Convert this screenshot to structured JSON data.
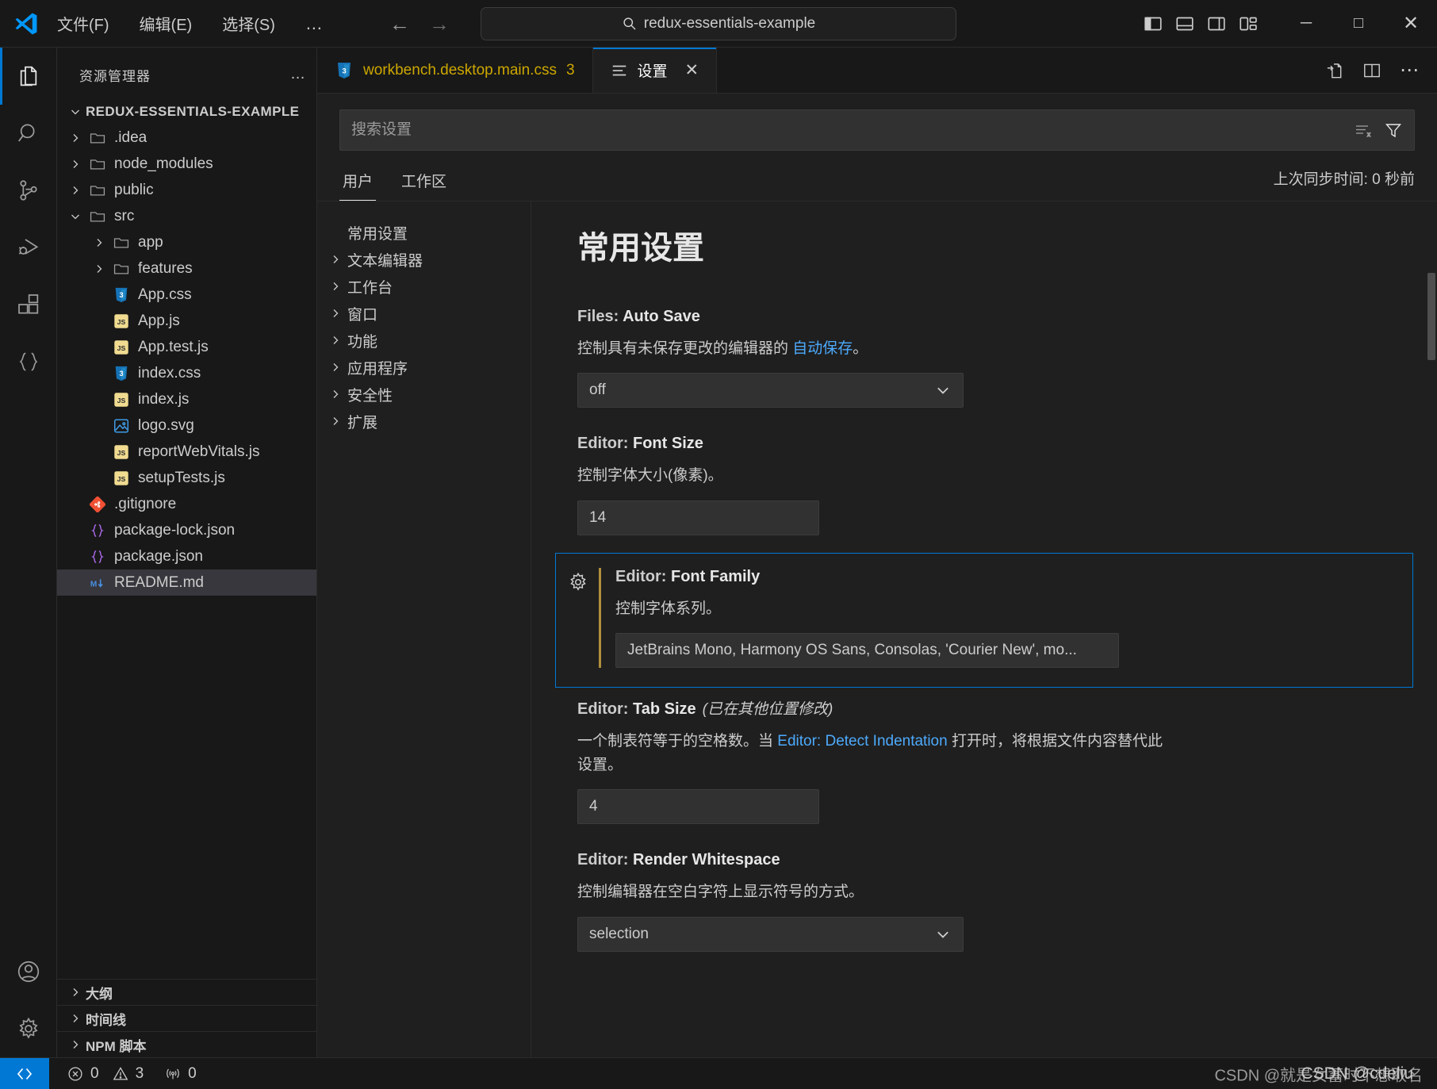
{
  "titlebar": {
    "logo_name": "vscode-logo",
    "menus": [
      "文件(F)",
      "编辑(E)",
      "选择(S)"
    ],
    "menu_overflow": "…",
    "nav_back": "←",
    "nav_forward": "→",
    "command_center": {
      "icon": "search-icon",
      "text": "redux-essentials-example"
    },
    "layout_icons": [
      "toggle-primary-sidebar-icon",
      "toggle-panel-icon",
      "toggle-secondary-sidebar-icon",
      "customize-layout-icon"
    ],
    "window_controls": {
      "minimize": "─",
      "maximize": "□",
      "close": "✕"
    }
  },
  "activitybar": {
    "items": [
      {
        "name": "explorer",
        "icon": "files-icon",
        "active": true
      },
      {
        "name": "search",
        "icon": "search-icon",
        "active": false
      },
      {
        "name": "source-control",
        "icon": "source-control-icon",
        "active": false
      },
      {
        "name": "run-and-debug",
        "icon": "debug-icon",
        "active": false
      },
      {
        "name": "extensions",
        "icon": "extensions-icon",
        "active": false
      },
      {
        "name": "remote-explorer",
        "icon": "braces-icon",
        "active": false
      }
    ],
    "bottom_items": [
      {
        "name": "accounts",
        "icon": "account-icon"
      },
      {
        "name": "manage",
        "icon": "gear-icon"
      }
    ]
  },
  "sidebar": {
    "title": "资源管理器",
    "more_actions": "…",
    "root": {
      "label": "REDUX-ESSENTIALS-EXAMPLE",
      "expanded": true
    },
    "tree": [
      {
        "label": ".idea",
        "type": "folder",
        "depth": 1,
        "expanded": false
      },
      {
        "label": "node_modules",
        "type": "folder",
        "depth": 1,
        "expanded": false
      },
      {
        "label": "public",
        "type": "folder",
        "depth": 1,
        "expanded": false
      },
      {
        "label": "src",
        "type": "folder",
        "depth": 1,
        "expanded": true
      },
      {
        "label": "app",
        "type": "folder",
        "depth": 2,
        "expanded": false
      },
      {
        "label": "features",
        "type": "folder",
        "depth": 2,
        "expanded": false
      },
      {
        "label": "App.css",
        "type": "css",
        "depth": 2
      },
      {
        "label": "App.js",
        "type": "js",
        "depth": 2
      },
      {
        "label": "App.test.js",
        "type": "js",
        "depth": 2
      },
      {
        "label": "index.css",
        "type": "css",
        "depth": 2
      },
      {
        "label": "index.js",
        "type": "js",
        "depth": 2
      },
      {
        "label": "logo.svg",
        "type": "svg",
        "depth": 2
      },
      {
        "label": "reportWebVitals.js",
        "type": "js",
        "depth": 2
      },
      {
        "label": "setupTests.js",
        "type": "js",
        "depth": 2
      },
      {
        "label": ".gitignore",
        "type": "git",
        "depth": 1
      },
      {
        "label": "package-lock.json",
        "type": "json",
        "depth": 1
      },
      {
        "label": "package.json",
        "type": "json",
        "depth": 1
      },
      {
        "label": "README.md",
        "type": "md",
        "depth": 1,
        "selected": true
      }
    ],
    "panels": [
      "大纲",
      "时间线",
      "NPM 脚本"
    ]
  },
  "editor": {
    "tabs": [
      {
        "label": "workbench.desktop.main.css",
        "badge": "3",
        "icon": "css-icon",
        "active": false
      },
      {
        "label": "设置",
        "icon": "settings-tab-icon",
        "active": true,
        "closable": true
      }
    ],
    "close_glyph": "✕",
    "actions": [
      "open-changes-icon",
      "split-editor-icon",
      "more-actions-icon"
    ],
    "more_glyph": "⋯"
  },
  "settings": {
    "search_placeholder": "搜索设置",
    "search_value": "",
    "search_icons": [
      "clear-filters-icon",
      "filter-icon"
    ],
    "scope_tabs": [
      {
        "label": "用户",
        "active": true
      },
      {
        "label": "工作区",
        "active": false
      }
    ],
    "sync_status": "上次同步时间: 0 秒前",
    "toc": [
      {
        "label": "常用设置",
        "hasArrow": false,
        "active": true
      },
      {
        "label": "文本编辑器",
        "hasArrow": true
      },
      {
        "label": "工作台",
        "hasArrow": true
      },
      {
        "label": "窗口",
        "hasArrow": true
      },
      {
        "label": "功能",
        "hasArrow": true
      },
      {
        "label": "应用程序",
        "hasArrow": true
      },
      {
        "label": "安全性",
        "hasArrow": true
      },
      {
        "label": "扩展",
        "hasArrow": true
      }
    ],
    "page_title": "常用设置",
    "items": [
      {
        "key": "files-auto-save",
        "prefix": "Files: ",
        "name": "Auto Save",
        "note": "",
        "desc_before": "控制具有未保存更改的编辑器的 ",
        "desc_link": "自动保存",
        "desc_after": "。",
        "control": "select",
        "value": "off",
        "caret": "⌄"
      },
      {
        "key": "editor-font-size",
        "prefix": "Editor: ",
        "name": "Font Size",
        "note": "",
        "desc_before": "控制字体大小(像素)。",
        "desc_link": "",
        "desc_after": "",
        "control": "input",
        "value": "14"
      },
      {
        "key": "editor-font-family",
        "prefix": "Editor: ",
        "name": "Font Family",
        "note": "",
        "desc_before": "控制字体系列。",
        "desc_link": "",
        "desc_after": "",
        "control": "input-wide",
        "value": "JetBrains Mono, Harmony OS Sans, Consolas, 'Courier New', mo...",
        "focused": true,
        "modified": true,
        "gear_icon": "gear-icon"
      },
      {
        "key": "editor-tab-size",
        "prefix": "Editor: ",
        "name": "Tab Size",
        "note": "(已在其他位置修改)",
        "desc_before": "一个制表符等于的空格数。当 ",
        "desc_link": "Editor: Detect Indentation",
        "desc_after": " 打开时，将根据文件内容替代此设置。",
        "control": "input",
        "value": "4"
      },
      {
        "key": "editor-render-whitespace",
        "prefix": "Editor: ",
        "name": "Render Whitespace",
        "note": "",
        "desc_before": "控制编辑器在空白字符上显示符号的方式。",
        "desc_link": "",
        "desc_after": "",
        "control": "select",
        "value": "selection",
        "caret": "⌄"
      }
    ]
  },
  "statusbar": {
    "remote_icon": "remote-window-icon",
    "problems": {
      "errors_icon": "error-icon",
      "errors": "0",
      "warnings_icon": "warning-icon",
      "warnings": "3"
    },
    "ports": {
      "icon": "radio-tower-icon",
      "count": "0"
    },
    "watermark": "CSDN @就是女蓄时不想取名",
    "watermark_overlay": "CSDN @cdeliu"
  },
  "colors": {
    "accent": "#0078d4",
    "link": "#4daafc",
    "modified_bar": "#b08f3d",
    "bg": "#1f1f1f",
    "panel_bg": "#181818",
    "border": "#2b2b2b",
    "text": "#cccccc"
  }
}
